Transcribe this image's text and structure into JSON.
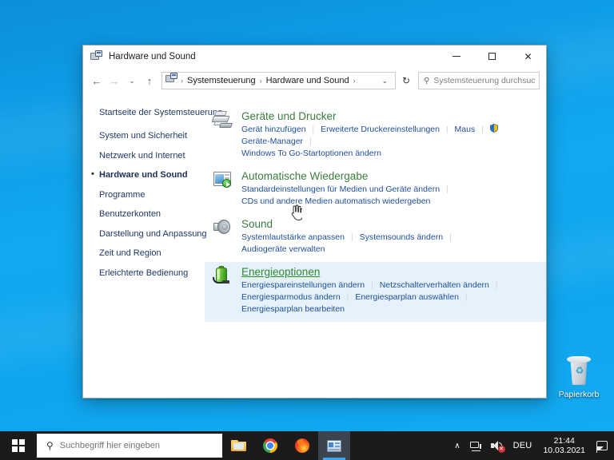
{
  "window": {
    "title": "Hardware und Sound",
    "icon": "control-panel-icon",
    "controls": {
      "minimize": "–",
      "maximize": "□",
      "close": "✕"
    },
    "nav": {
      "back": "←",
      "forward": "→",
      "recent": "⌄",
      "up": "↑",
      "dropdown": "⌄",
      "refresh": "↻"
    },
    "breadcrumb": {
      "items": [
        "Systemsteuerung",
        "Hardware und Sound"
      ],
      "separator": "›"
    },
    "search": {
      "placeholder": "Systemsteuerung durchsuch...",
      "value": "",
      "icon": "search-icon"
    }
  },
  "sidebar": {
    "home": "Startseite der Systemsteuerung",
    "items": [
      {
        "label": "System und Sicherheit",
        "active": false
      },
      {
        "label": "Netzwerk und Internet",
        "active": false
      },
      {
        "label": "Hardware und Sound",
        "active": true
      },
      {
        "label": "Programme",
        "active": false
      },
      {
        "label": "Benutzerkonten",
        "active": false
      },
      {
        "label": "Darstellung und Anpassung",
        "active": false
      },
      {
        "label": "Zeit und Region",
        "active": false
      },
      {
        "label": "Erleichterte Bedienung",
        "active": false
      }
    ]
  },
  "categories": [
    {
      "title": "Geräte und Drucker",
      "icon": "devices-printers-icon",
      "hovered": false,
      "links_rows": [
        [
          {
            "text": "Gerät hinzufügen",
            "shield": false
          },
          {
            "text": "Erweiterte Druckereinstellungen",
            "shield": false
          },
          {
            "text": "Maus",
            "shield": false
          },
          {
            "text": "Geräte-Manager",
            "shield": true
          }
        ],
        [
          {
            "text": "Windows To Go-Startoptionen ändern",
            "shield": false
          }
        ]
      ],
      "trailing_separator": true
    },
    {
      "title": "Automatische Wiedergabe",
      "icon": "autoplay-icon",
      "hovered": false,
      "links_rows": [
        [
          {
            "text": "Standardeinstellungen für Medien und Geräte ändern",
            "shield": false
          }
        ],
        [
          {
            "text": "CDs und andere Medien automatisch wiedergeben",
            "shield": false
          }
        ]
      ],
      "trailing_separator": true
    },
    {
      "title": "Sound",
      "icon": "sound-icon",
      "hovered": false,
      "links_rows": [
        [
          {
            "text": "Systemlautstärke anpassen",
            "shield": false
          },
          {
            "text": "Systemsounds ändern",
            "shield": false
          },
          {
            "text": "Audiogeräte verwalten",
            "shield": false
          }
        ]
      ],
      "trailing_separator": false
    },
    {
      "title": "Energieoptionen",
      "icon": "power-options-icon",
      "hovered": true,
      "links_rows": [
        [
          {
            "text": "Energiespareinstellungen ändern",
            "shield": false
          },
          {
            "text": "Netzschalterverhalten ändern",
            "shield": false
          }
        ],
        [
          {
            "text": "Energiesparmodus ändern",
            "shield": false
          },
          {
            "text": "Energiesparplan auswählen",
            "shield": false
          },
          {
            "text": "Energiesparplan bearbeiten",
            "shield": false
          }
        ]
      ],
      "trailing_separator": true
    }
  ],
  "desktop": {
    "recycle_bin": {
      "label": "Papierkorb",
      "icon": "recycle-bin-icon"
    }
  },
  "taskbar": {
    "start": {
      "icon": "windows-start-icon"
    },
    "search": {
      "placeholder": "Suchbegriff hier eingeben",
      "value": "",
      "icon": "search-icon"
    },
    "apps": [
      {
        "name": "file-explorer",
        "icon": "file-explorer-icon",
        "active": false
      },
      {
        "name": "google-chrome",
        "icon": "chrome-icon",
        "active": false
      },
      {
        "name": "mozilla-firefox",
        "icon": "firefox-icon",
        "active": false
      },
      {
        "name": "control-panel",
        "icon": "control-panel-icon",
        "active": true
      }
    ],
    "tray": {
      "overflow": "∧",
      "network": "network-icon",
      "volume": "volume-muted-icon",
      "volume_badge": "✕",
      "language": "DEU",
      "time": "21:44",
      "date": "10.03.2021",
      "notifications": "action-center-icon"
    }
  },
  "colors": {
    "accent": "#0078d7",
    "category_title": "#3b7d3e",
    "link": "#1f4e9c",
    "hover_row": "#e5f2fb",
    "taskbar": "#1b1b1b"
  }
}
